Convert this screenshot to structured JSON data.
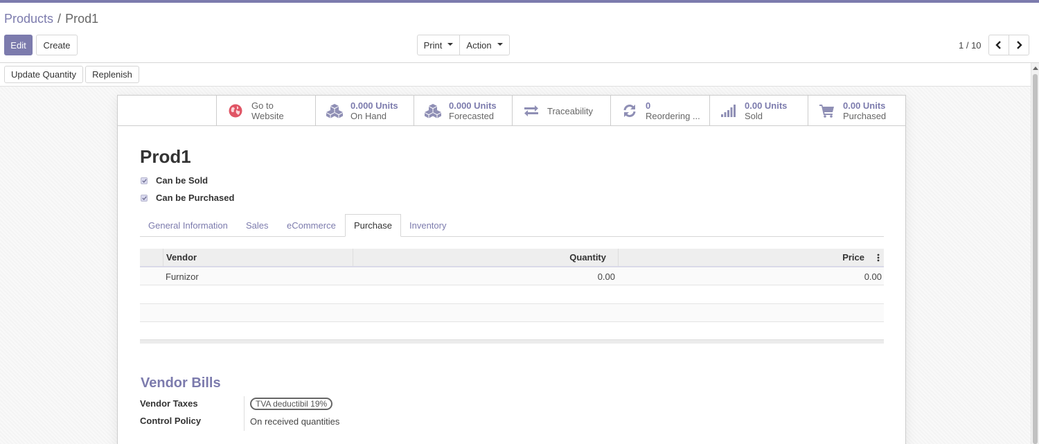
{
  "breadcrumb": {
    "parent": "Products",
    "separator": "/",
    "current": "Prod1"
  },
  "toolbar": {
    "edit_label": "Edit",
    "create_label": "Create",
    "print_label": "Print",
    "action_label": "Action"
  },
  "pager": {
    "value": "1 / 10"
  },
  "statusbar": {
    "update_quantity_label": "Update Quantity",
    "replenish_label": "Replenish"
  },
  "smart_buttons": {
    "website": {
      "line1": "Go to",
      "line2": "Website",
      "icon": "globe-icon"
    },
    "on_hand": {
      "value": "0.000 Units",
      "label": "On Hand",
      "icon": "cubes-icon"
    },
    "forecasted": {
      "value": "0.000 Units",
      "label": "Forecasted",
      "icon": "cubes-icon"
    },
    "traceability": {
      "label": "Traceability",
      "icon": "arrows-exchange-icon"
    },
    "reordering": {
      "value": "0",
      "label": "Reordering ...",
      "icon": "refresh-icon"
    },
    "sold": {
      "value": "0.00 Units",
      "label": "Sold",
      "icon": "signal-icon"
    },
    "purchased": {
      "value": "0.00 Units",
      "label": "Purchased",
      "icon": "cart-icon"
    }
  },
  "product": {
    "name": "Prod1",
    "can_be_sold_label": "Can be Sold",
    "can_be_purchased_label": "Can be Purchased"
  },
  "tabs": [
    "General Information",
    "Sales",
    "eCommerce",
    "Purchase",
    "Inventory"
  ],
  "active_tab": "Purchase",
  "vendor_table": {
    "headers": {
      "vendor": "Vendor",
      "quantity": "Quantity",
      "price": "Price"
    },
    "rows": [
      {
        "vendor": "Furnizor",
        "quantity": "0.00",
        "price": "0.00"
      }
    ]
  },
  "vendor_bills": {
    "title": "Vendor Bills",
    "vendor_taxes_label": "Vendor Taxes",
    "vendor_taxes_tag": "TVA deductibil 19%",
    "control_policy_label": "Control Policy",
    "control_policy_value": "On received quantities"
  },
  "colors": {
    "brand": "#7c7bad",
    "globe": "#e05565"
  }
}
